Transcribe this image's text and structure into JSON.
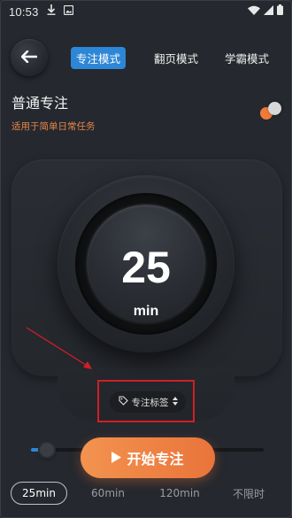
{
  "status_bar": {
    "time": "10:53"
  },
  "header": {
    "tabs": [
      {
        "label": "专注模式",
        "active": true
      },
      {
        "label": "翻页模式",
        "active": false
      },
      {
        "label": "学霸模式",
        "active": false
      }
    ]
  },
  "mode": {
    "title": "普通专注",
    "subtitle": "适用于简单日常任务"
  },
  "dial": {
    "value": "25",
    "unit": "min"
  },
  "tag": {
    "label": "专注标签"
  },
  "slider": {
    "level": 0.07
  },
  "start_button": {
    "label": "开始专注"
  },
  "durations": [
    {
      "label": "25min",
      "selected": true
    },
    {
      "label": "60min",
      "selected": false
    },
    {
      "label": "120min",
      "selected": false
    },
    {
      "label": "不限时",
      "selected": false
    }
  ],
  "colors": {
    "accent_blue": "#2d86d6",
    "accent_orange": "#ef8444",
    "annotation_red": "#d01f26",
    "background": "#25282e"
  }
}
